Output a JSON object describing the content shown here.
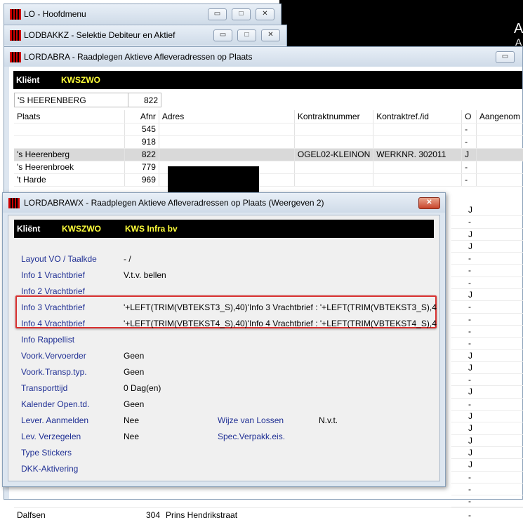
{
  "windows": {
    "hoofdmenu": {
      "title": "LO - Hoofdmenu"
    },
    "lodbakkz": {
      "title": "LODBAKKZ - Selektie Debiteur en Aktief"
    },
    "lordabra": {
      "title": "LORDABRA - Raadplegen Aktieve Afleveradressen op Plaats",
      "klient_label": "Kliënt",
      "klient_value": "KWSZWO",
      "filter_plaats": "'S HEERENBERG",
      "filter_nr": "822",
      "columns": [
        "Plaats",
        "Afnr",
        "Adres",
        "Kontraktnummer",
        "Kontraktref./id",
        "O",
        "Aangenom"
      ],
      "rows": [
        {
          "plaats": "",
          "afnr": "545",
          "adres": "",
          "kontrakt": "",
          "ref": "",
          "o": "-"
        },
        {
          "plaats": "",
          "afnr": "918",
          "adres": "",
          "kontrakt": "",
          "ref": "",
          "o": "-"
        },
        {
          "plaats": "'s Heerenberg",
          "afnr": "822",
          "adres": "",
          "kontrakt": "OGEL02-KLEINON",
          "ref": "WERKNR. 302011",
          "o": "J"
        },
        {
          "plaats": "'s Heerenbroek",
          "afnr": "779",
          "adres": "",
          "kontrakt": "",
          "ref": "",
          "o": "-"
        },
        {
          "plaats": "'t Harde",
          "afnr": "969",
          "adres": "",
          "kontrakt": "",
          "ref": "",
          "o": "-"
        }
      ],
      "side_o_values": [
        "J",
        "-",
        "J",
        "J",
        "-",
        "-",
        "-",
        "J",
        "-",
        "-",
        "-",
        "-",
        "J",
        "J",
        "-",
        "J",
        "-",
        "J",
        "J",
        "J",
        "J",
        "J",
        "-",
        "-",
        "-"
      ],
      "bottom_row": {
        "plaats": "Dalfsen",
        "afnr": "304",
        "adres": "Prins Hendrikstraat",
        "o": "-"
      }
    },
    "lordabrawx": {
      "title": "LORDABRAWX - Raadplegen Aktieve Afleveradressen op Plaats (Weergeven 2)",
      "klient_label": "Kliënt",
      "klient_value": "KWSZWO",
      "klient_name": "KWS Infra bv",
      "fields": {
        "layout_label": "Layout VO / Taalkde",
        "layout_value": "-  /",
        "info1_label": "Info 1 Vrachtbrief",
        "info1_value": "V.t.v. bellen",
        "info2_label": "Info 2 Vrachtbrief",
        "info2_value": "",
        "info3_label": "Info 3 Vrachtbrief",
        "info3_value": "'+LEFT(TRIM(VBTEKST3_S),40)'Info 3 Vrachtbrief : '+LEFT(TRIM(VBTEKST3_S),4",
        "info4_label": "Info 4 Vrachtbrief",
        "info4_value": "'+LEFT(TRIM(VBTEKST4_S),40)'Info 4 Vrachtbrief : '+LEFT(TRIM(VBTEKST4_S),4",
        "rappel_label": "Info Rappellist",
        "rappel_value": "",
        "vervoerder_label": "Voork.Vervoerder",
        "vervoerder_value": "Geen",
        "transp_label": "Voork.Transp.typ.",
        "transp_value": "Geen",
        "transporttijd_label": "Transporttijd",
        "transporttijd_value": "0 Dag(en)",
        "kalender_label": "Kalender Open.td.",
        "kalender_value": "Geen",
        "lever_label": "Lever. Aanmelden",
        "lever_value": "Nee",
        "lossen_label": "Wijze van Lossen",
        "lossen_value": "N.v.t.",
        "verzegelen_label": "Lev. Verzegelen",
        "verzegelen_value": "Nee",
        "verpakk_label": "Spec.Verpakk.eis.",
        "verpakk_value": "",
        "stickers_label": "Type Stickers",
        "stickers_value": "",
        "dkk_label": "DKK-Aktivering",
        "dkk_value": ""
      }
    }
  },
  "background_letters": [
    "A",
    "A"
  ],
  "title_buttons": {
    "minimize": "▭",
    "maximize": "□",
    "close": "✕"
  },
  "colors": {
    "label_blue": "#1f2f94",
    "highlight_red": "#d9302f",
    "klient_yellow": "#ffff3a"
  }
}
